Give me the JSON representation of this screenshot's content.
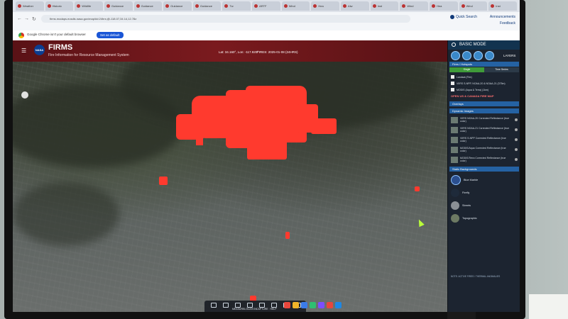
{
  "browser": {
    "tabs": [
      "Weather",
      "Historic",
      "Wildlife",
      "Guidance",
      "Guidance",
      "Guidance",
      "Guidance",
      "Tw",
      "ARTF",
      "Wind",
      "Hea",
      "Alw",
      "Inst",
      "Wind",
      "Hea",
      "Wind",
      "Inst"
    ],
    "url": "firms.modaps.eosdis.nasa.gov/map/#d:24hrs;@-118.07,34.14,12.78z",
    "quick_search": "Quick Search",
    "announcements": "Announcements",
    "feedback": "Feedback",
    "default_prompt": "Google Chrome isn't your default browser",
    "set_default": "Set as default"
  },
  "firms": {
    "logo": "NASA",
    "title": "FIRMS",
    "subtitle": "Fire Information for Resource Management System",
    "coords": "Lat: 34.160°, Lon: -117.920°",
    "fires_date": "FIRES: 2025-01-08 (24HRS)"
  },
  "panel": {
    "mode": "BASIC MODE",
    "layers_label": "LAYERS",
    "section_fires": "Fires / Hotspots",
    "subtab_single": "Single",
    "subtab_time": "Time Series",
    "fire_items": [
      "Landsat (Fire)",
      "VIIRS S-NPP, NOAA-20 & NOAA-21 (375m)",
      "MODIS (Aqua & Terra) (1km)"
    ],
    "us_canada": "OPEN US & CANADA FIRE MAP",
    "section_overlays": "Overlays",
    "section_dynamic": "Dynamic Images",
    "dynamic_items": [
      "VIIRS NOAA-20 Corrected Reflectance (true color)",
      "VIIRS NOAA-21 Corrected Reflectance (true color)",
      "VIIRS S-NPP Corrected Reflectance (true color)",
      "MODIS/Aqua Corrected Reflectance (true color)",
      "MODIS/Terra Corrected Reflectance (true color)"
    ],
    "section_static": "Static Backgrounds",
    "backgrounds": [
      "Blue Marble",
      "Firefly",
      "Streets",
      "Topographic"
    ],
    "note": "NOTE: ACTIVE FIRES / THERMAL ANOMALIES"
  },
  "toolbar": {
    "items": [
      "",
      "",
      "MEASURE",
      "LOCATION",
      "CAPTURE",
      "HELP",
      "",
      ""
    ]
  },
  "colors": {
    "burn": "#ff3a2e",
    "firms_bar": "#7a1a1e",
    "panel_bg": "#1c2430",
    "accent_blue": "#2562a3",
    "cursor": "#b9ff3a"
  }
}
